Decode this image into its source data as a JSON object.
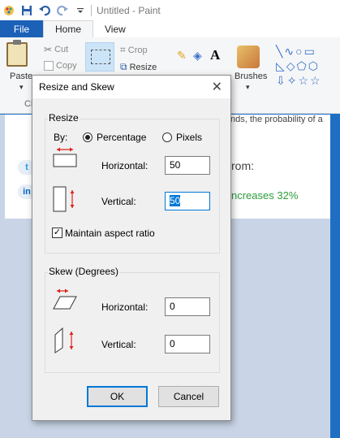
{
  "app": {
    "title": "Untitled - Paint"
  },
  "tabs": {
    "file": "File",
    "home": "Home",
    "view": "View"
  },
  "ribbon": {
    "paste": "Paste",
    "cut": "Cut",
    "copy": "Copy",
    "crop": "Crop",
    "resize": "Resize",
    "brushes": "Brushes",
    "clipboard_group_partial": "Cl"
  },
  "background": {
    "text_line": "nds, the probability of a",
    "from_text": "rom:",
    "increase_text": "ncreases 32%",
    "social": [
      "t",
      "in"
    ]
  },
  "dialog": {
    "title": "Resize and Skew",
    "resize_group": "Resize",
    "by_label": "By:",
    "percentage_label": "Percentage",
    "pixels_label": "Pixels",
    "selected_unit": "Percentage",
    "horizontal_label": "Horizontal:",
    "vertical_label": "Vertical:",
    "resize_horizontal_value": "50",
    "resize_vertical_value": "50",
    "maintain_aspect_label": "Maintain aspect ratio",
    "maintain_aspect_checked": true,
    "skew_group": "Skew (Degrees)",
    "skew_horizontal_label": "Horizontal:",
    "skew_vertical_label": "Vertical:",
    "skew_horizontal_value": "0",
    "skew_vertical_value": "0",
    "ok_label": "OK",
    "cancel_label": "Cancel"
  },
  "colors": {
    "accent": "#0078d7",
    "file_tab": "#1c61b8",
    "arrow_red": "#e0201a"
  }
}
